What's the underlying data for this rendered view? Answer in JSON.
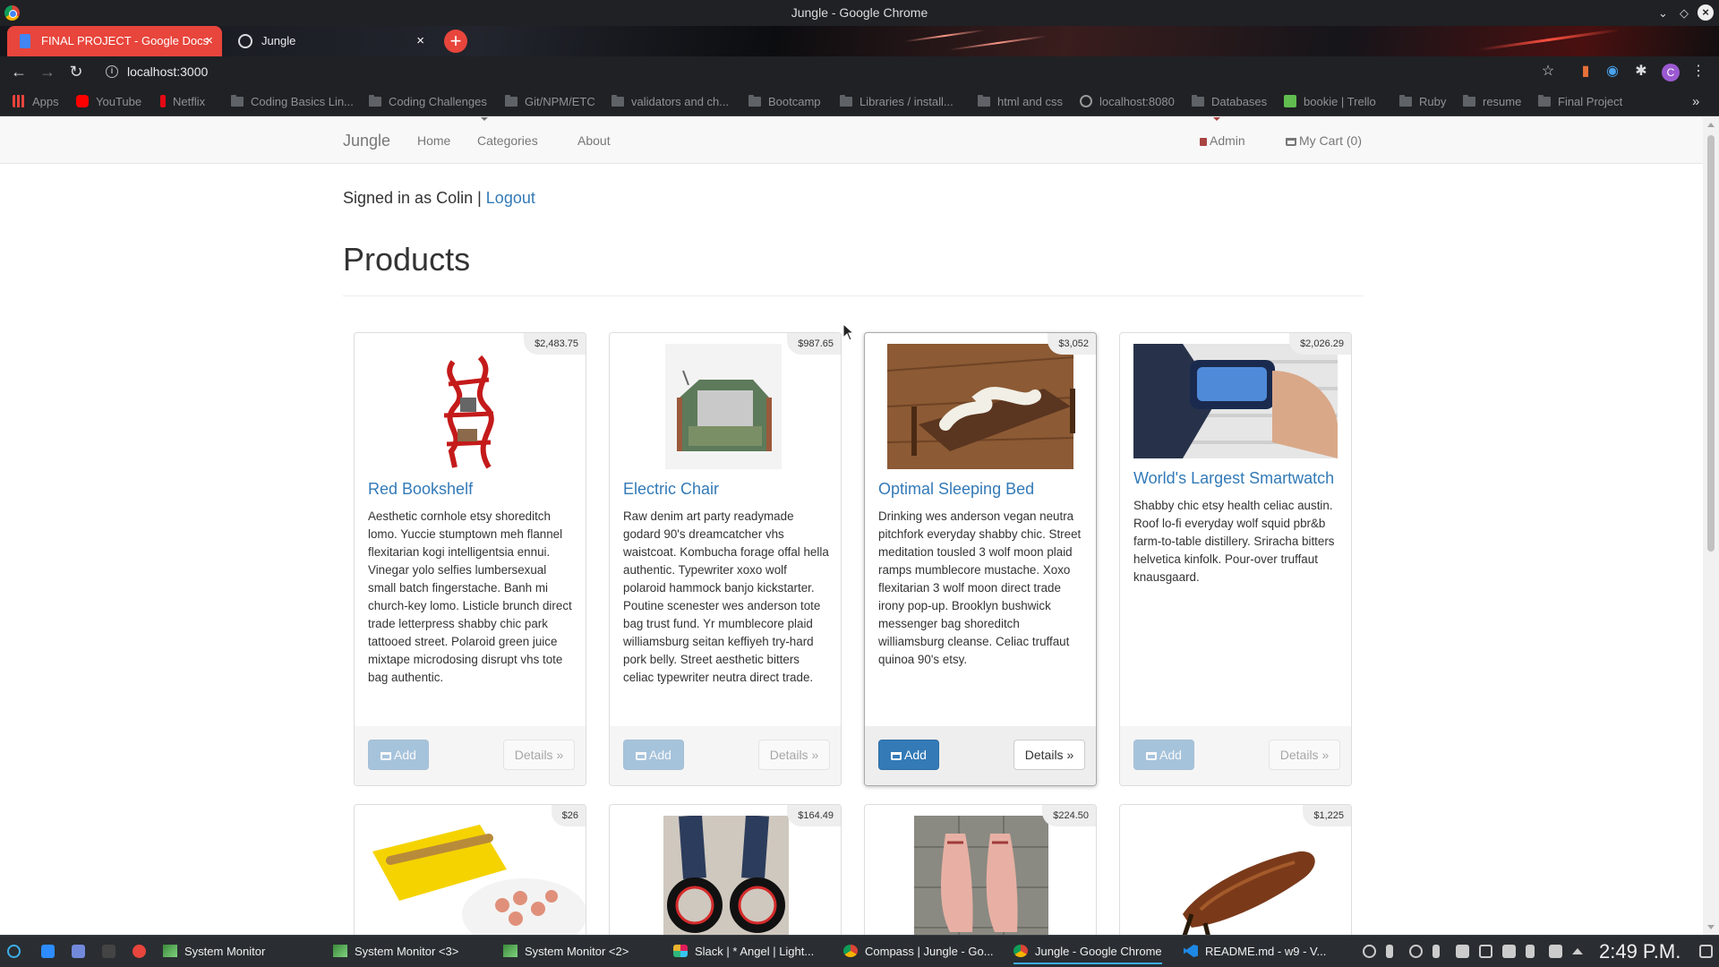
{
  "window": {
    "title": "Jungle - Google Chrome"
  },
  "tabs": [
    {
      "label": "FINAL PROJECT - Google Docs",
      "close": "×"
    },
    {
      "label": "Jungle",
      "close": "×"
    }
  ],
  "toolbar": {
    "url": "localhost:3000"
  },
  "bookmarks": [
    "Apps",
    "YouTube",
    "Netflix",
    "Coding Basics Lin...",
    "Coding Challenges",
    "Git/NPM/ETC",
    "validators and ch...",
    "Bootcamp",
    "Libraries / install...",
    "html and css",
    "localhost:8080",
    "Databases",
    "bookie | Trello",
    "Ruby",
    "resume",
    "Final Project"
  ],
  "nav": {
    "brand": "Jungle",
    "home": "Home",
    "categories": "Categories",
    "about": "About",
    "admin": "Admin",
    "cart": "My Cart (0)"
  },
  "session": {
    "signed_in": "Signed in as Colin |",
    "logout": "Logout"
  },
  "page": {
    "title": "Products"
  },
  "buttons": {
    "add": "Add",
    "details": "Details »"
  },
  "products": [
    {
      "name": "Red Bookshelf",
      "price": "$2,483.75",
      "description": "Aesthetic cornhole etsy shoreditch lomo. Yuccie stumptown meh flannel flexitarian kogi intelligentsia ennui. Vinegar yolo selfies lumbersexual small batch fingerstache. Banh mi church-key lomo. Listicle brunch direct trade letterpress shabby chic park tattooed street. Polaroid green juice mixtape microdosing disrupt vhs tote bag authentic."
    },
    {
      "name": "Electric Chair",
      "price": "$987.65",
      "description": "Raw denim art party readymade godard 90's dreamcatcher vhs waistcoat. Kombucha forage offal hella authentic. Typewriter xoxo wolf polaroid hammock banjo kickstarter. Poutine scenester wes anderson tote bag trust fund. Yr mumblecore plaid williamsburg seitan keffiyeh try-hard pork belly. Street aesthetic bitters celiac typewriter neutra direct trade."
    },
    {
      "name": "Optimal Sleeping Bed",
      "price": "$3,052",
      "description": "Drinking wes anderson vegan neutra pitchfork everyday shabby chic. Street meditation tousled 3 wolf moon plaid ramps mumblecore mustache. Xoxo flexitarian 3 wolf moon direct trade irony pop-up. Brooklyn bushwick messenger bag shoreditch williamsburg cleanse. Celiac truffaut quinoa 90's etsy."
    },
    {
      "name": "World's Largest Smartwatch",
      "price": "$2,026.29",
      "description": "Shabby chic etsy health celiac austin. Roof lo-fi everyday wolf squid pbr&b farm-to-table distillery. Sriracha bitters helvetica kinfolk. Pour-over truffaut knausgaard."
    },
    {
      "price": "$26"
    },
    {
      "price": "$164.49"
    },
    {
      "price": "$224.50"
    },
    {
      "price": "$1,225"
    }
  ],
  "taskbar": {
    "tasks": [
      "System Monitor",
      "System Monitor <3>",
      "System Monitor <2>",
      "Slack | * Angel | Light...",
      "Compass | Jungle - Go...",
      "Jungle - Google Chrome",
      "README.md - w9 - V..."
    ],
    "clock": "2:49 P.M."
  },
  "colors": {
    "link": "#337ab7",
    "primary": "#337ab7",
    "admin": "#a94442",
    "tab_active": "#e8453c"
  }
}
